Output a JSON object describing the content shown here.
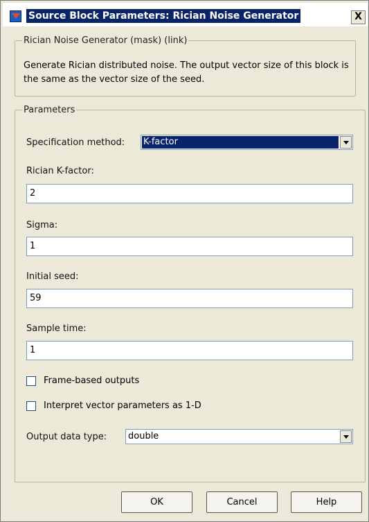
{
  "window": {
    "title": "Source Block Parameters: Rician Noise Generator",
    "close_label": "X"
  },
  "description_group": {
    "legend": "Rician Noise Generator (mask) (link)",
    "text": "Generate Rician distributed noise. The output vector size of this block is the same as the vector size of the seed."
  },
  "parameters": {
    "legend": "Parameters",
    "specification_method": {
      "label": "Specification method:",
      "value": "K-factor"
    },
    "rician_k_factor": {
      "label": "Rician K-factor:",
      "value": "2"
    },
    "sigma": {
      "label": "Sigma:",
      "value": "1"
    },
    "initial_seed": {
      "label": "Initial seed:",
      "value": "59"
    },
    "sample_time": {
      "label": "Sample time:",
      "value": "1"
    },
    "frame_based": {
      "label": "Frame-based outputs",
      "checked": false
    },
    "interpret_1d": {
      "label": "Interpret vector parameters as 1-D",
      "checked": false
    },
    "output_data_type": {
      "label": "Output data type:",
      "value": "double"
    }
  },
  "buttons": {
    "ok": "OK",
    "cancel": "Cancel",
    "help": "Help"
  },
  "colors": {
    "dialog_bg": "#ece9d8",
    "title_highlight": "#0a246a",
    "selection": "#0a246a",
    "input_border": "#7f9db9"
  }
}
